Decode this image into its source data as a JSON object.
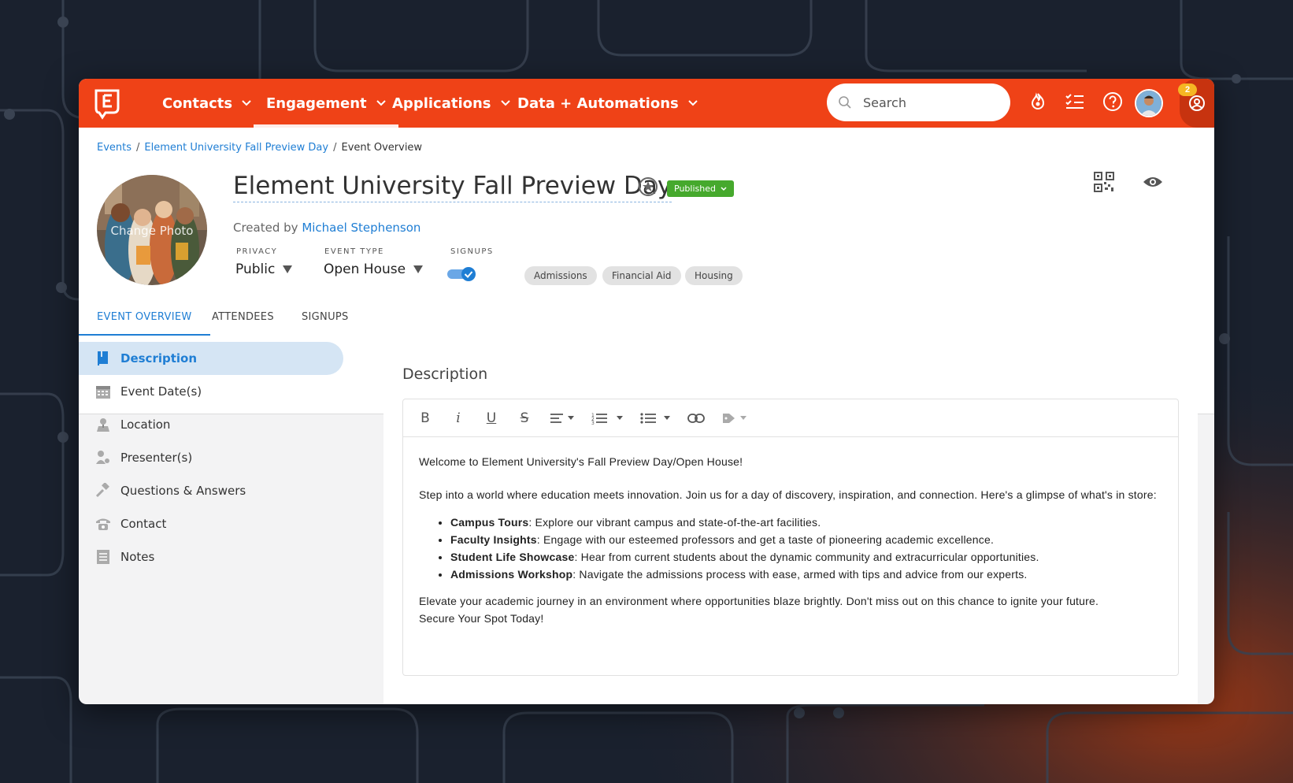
{
  "colors": {
    "brand": "#ef4217",
    "link": "#1f7ed4",
    "published": "#46a92d",
    "notif_badge": "#f5b623"
  },
  "topnav": {
    "items": [
      {
        "label": "Contacts"
      },
      {
        "label": "Engagement"
      },
      {
        "label": "Applications"
      },
      {
        "label": "Data + Automations"
      }
    ],
    "search_placeholder": "Search",
    "notification_count": "2",
    "icons": [
      "flame-icon",
      "checklist-icon",
      "help-icon",
      "avatar",
      "account-icon"
    ]
  },
  "breadcrumb": {
    "items": [
      "Events",
      "Element University Fall Preview Day"
    ],
    "current": "Event Overview"
  },
  "event": {
    "photo_label": "Change Photo",
    "title": "Element University Fall Preview Day",
    "status": "Published",
    "created_by_label": "Created by",
    "created_by": "Michael Stephenson",
    "privacy_label": "PRIVACY",
    "privacy_value": "Public",
    "event_type_label": "EVENT TYPE",
    "event_type_value": "Open House",
    "signups_label": "SIGNUPS",
    "signups_enabled": true,
    "tags": [
      "Admissions",
      "Financial Aid",
      "Housing"
    ]
  },
  "tabs": [
    "EVENT OVERVIEW",
    "ATTENDEES",
    "SIGNUPS"
  ],
  "sidebar": {
    "items": [
      {
        "label": "Description",
        "icon": "book-icon"
      },
      {
        "label": "Event Date(s)",
        "icon": "calendar-icon"
      },
      {
        "label": "Location",
        "icon": "location-icon"
      },
      {
        "label": "Presenter(s)",
        "icon": "presenter-icon"
      },
      {
        "label": "Questions & Answers",
        "icon": "gavel-icon"
      },
      {
        "label": "Contact",
        "icon": "phone-icon"
      },
      {
        "label": "Notes",
        "icon": "notes-icon"
      }
    ]
  },
  "content": {
    "title": "Description",
    "intro": "Welcome to Element University's Fall Preview Day/Open House!",
    "paragraph1": "Step into a world where education meets innovation. Join us for a day of discovery, inspiration, and connection. Here's a glimpse of what's in store:",
    "bullets": [
      {
        "bold": "Campus Tours",
        "text": ": Explore our vibrant campus and state-of-the-art facilities."
      },
      {
        "bold": "Faculty Insights",
        "text": ": Engage with our esteemed professors and get a taste of pioneering academic excellence."
      },
      {
        "bold": "Student Life Showcase",
        "text": ": Hear from current students about the dynamic community and extracurricular opportunities."
      },
      {
        "bold": "Admissions Workshop",
        "text": ": Navigate the admissions process with ease, armed with tips and advice from our experts."
      }
    ],
    "closing": "Elevate your academic journey in an environment where opportunities blaze brightly. Don't miss out on this chance to ignite your future.",
    "cta": "Secure Your Spot Today!"
  },
  "toolbar": {
    "bold": "B",
    "italic": "i",
    "underline": "U",
    "strike": "S"
  }
}
